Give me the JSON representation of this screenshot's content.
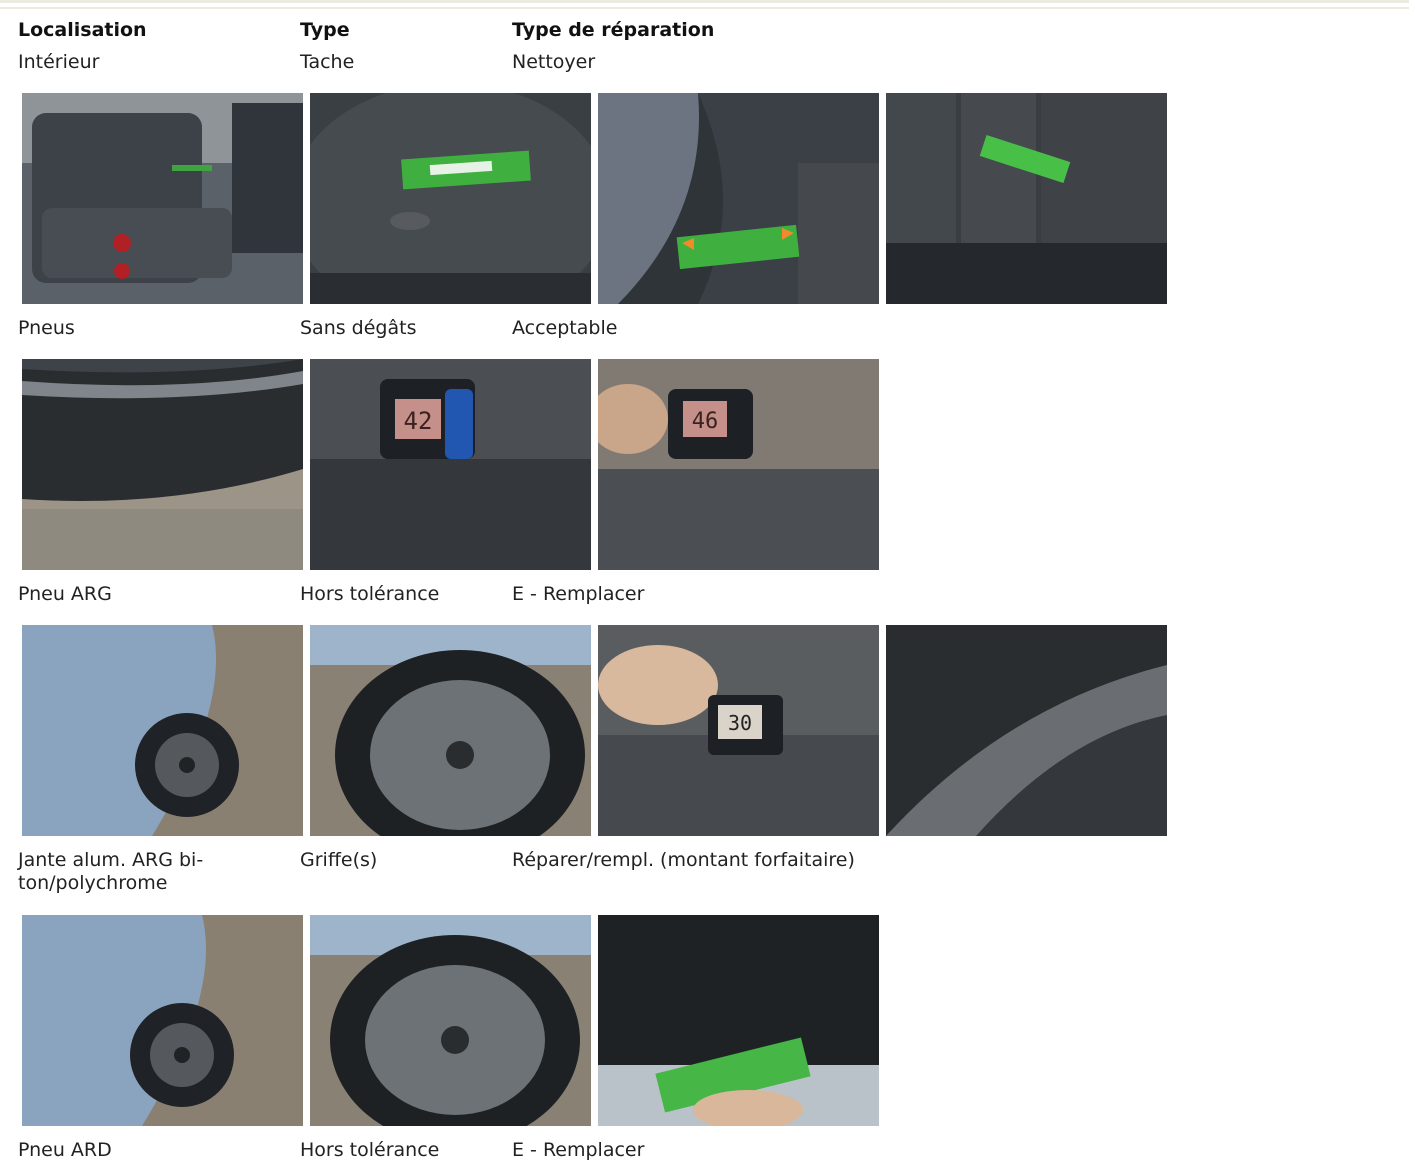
{
  "headers": {
    "location": "Localisation",
    "type": "Type",
    "repair": "Type de réparation"
  },
  "rows": [
    {
      "location": "Intérieur",
      "type": "Tache",
      "repair": "Nettoyer",
      "photos": [
        "rear-seat-photo",
        "seat-stain-ruler-photo",
        "seat-bolster-ruler-photo",
        "seat-back-ruler-photo"
      ]
    },
    {
      "location": "Pneus",
      "type": "Sans dégâts",
      "repair": "Acceptable",
      "photos": [
        "tire-sidewall-photo",
        "tread-depth-gauge-photo",
        "tread-depth-gauge-photo"
      ],
      "readings": [
        "42",
        "46"
      ]
    },
    {
      "location": "Pneu ARG",
      "type": "Hors tolérance",
      "repair": "E - Remplacer",
      "photos": [
        "car-rear-wheel-photo",
        "alloy-wheel-photo",
        "tread-depth-gauge-photo",
        "tire-size-marking-photo"
      ],
      "readings": [
        "30"
      ]
    },
    {
      "location": "Jante alum. ARG bi-ton/polychrome",
      "type": "Griffe(s)",
      "repair": "Réparer/rempl. (montant forfaitaire)",
      "photos": [
        "car-rear-wheel-photo",
        "alloy-wheel-photo",
        "rim-scratch-ruler-photo"
      ]
    },
    {
      "location": "Pneu ARD",
      "type": "Hors tolérance",
      "repair": "E - Remplacer"
    }
  ]
}
